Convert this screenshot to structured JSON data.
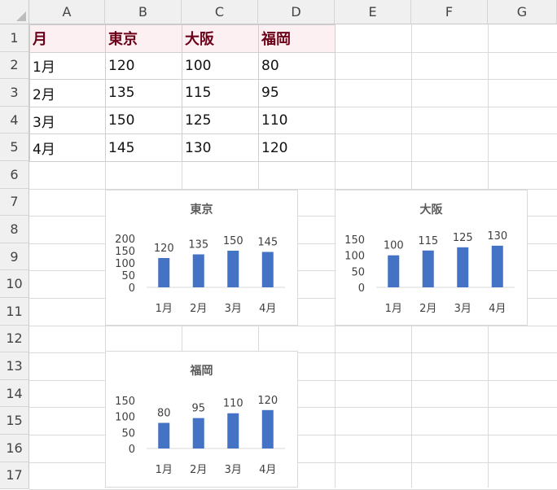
{
  "columns": [
    "A",
    "B",
    "C",
    "D",
    "E",
    "F",
    "G"
  ],
  "rows": [
    "1",
    "2",
    "3",
    "4",
    "5",
    "6",
    "7",
    "8",
    "9",
    "10",
    "11",
    "12",
    "13",
    "14",
    "15",
    "16",
    "17"
  ],
  "table": {
    "header": [
      "月",
      "東京",
      "大阪",
      "福岡"
    ],
    "rows": [
      [
        "1月",
        "120",
        "100",
        "80"
      ],
      [
        "2月",
        "135",
        "115",
        "95"
      ],
      [
        "3月",
        "150",
        "125",
        "110"
      ],
      [
        "4月",
        "145",
        "130",
        "120"
      ]
    ]
  },
  "colors": {
    "bar": "#4472C4",
    "header_fill": "#FDF0F2",
    "header_text": "#6B0018"
  },
  "chart_data": [
    {
      "type": "bar",
      "title": "東京",
      "categories": [
        "1月",
        "2月",
        "3月",
        "4月"
      ],
      "values": [
        120,
        135,
        150,
        145
      ],
      "yticks": [
        0,
        50,
        100,
        150,
        200
      ],
      "ylim": [
        0,
        200
      ],
      "data_labels": true
    },
    {
      "type": "bar",
      "title": "大阪",
      "categories": [
        "1月",
        "2月",
        "3月",
        "4月"
      ],
      "values": [
        100,
        115,
        125,
        130
      ],
      "yticks": [
        0,
        50,
        100,
        150
      ],
      "ylim": [
        0,
        150
      ],
      "data_labels": true
    },
    {
      "type": "bar",
      "title": "福岡",
      "categories": [
        "1月",
        "2月",
        "3月",
        "4月"
      ],
      "values": [
        80,
        95,
        110,
        120
      ],
      "yticks": [
        0,
        50,
        100,
        150
      ],
      "ylim": [
        0,
        150
      ],
      "data_labels": true
    }
  ]
}
